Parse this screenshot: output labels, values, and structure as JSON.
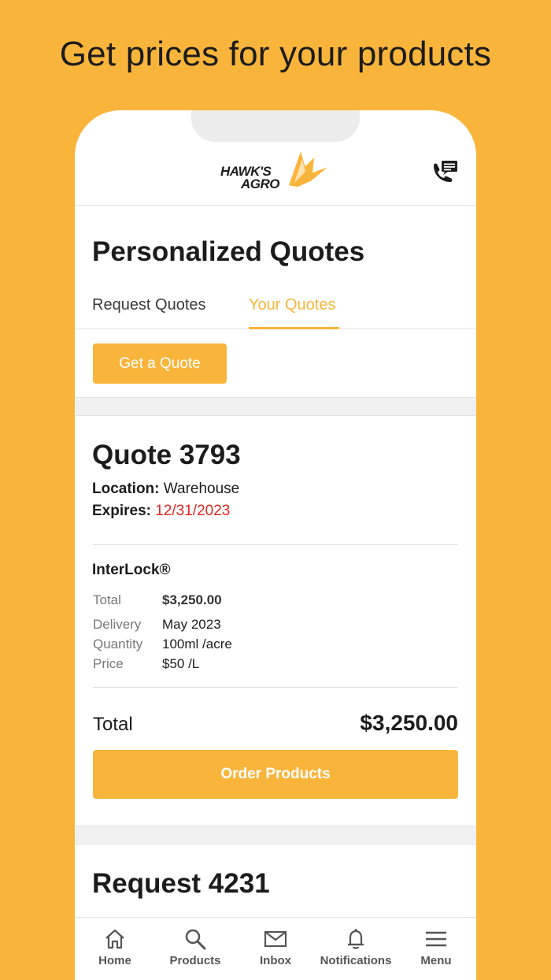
{
  "promo": {
    "headline": "Get prices for your products"
  },
  "header": {
    "logo_line1": "HAWK'S",
    "logo_line2": "AGRO",
    "brand_color": "#F9B53B",
    "contact_icon": "phone-message-icon"
  },
  "page": {
    "title": "Personalized Quotes",
    "tabs": [
      {
        "label": "Request Quotes",
        "active": false
      },
      {
        "label": "Your Quotes",
        "active": true
      }
    ],
    "get_quote_label": "Get a Quote"
  },
  "quote": {
    "title": "Quote 3793",
    "location_label": "Location:",
    "location_value": "Warehouse",
    "expires_label": "Expires:",
    "expires_value": "12/31/2023",
    "expires_color": "#e0271f",
    "product": {
      "name": "InterLock®",
      "rows": [
        {
          "label": "Total",
          "value": "$3,250.00"
        },
        {
          "label": "Delivery",
          "value": "May 2023"
        },
        {
          "label": "Quantity",
          "value": "100ml /acre"
        },
        {
          "label": "Price",
          "value": "$50 /L"
        }
      ]
    },
    "total_label": "Total",
    "total_value": "$3,250.00",
    "order_label": "Order Products"
  },
  "request": {
    "title": "Request 4231"
  },
  "nav": {
    "items": [
      {
        "label": "Home",
        "icon": "home-icon"
      },
      {
        "label": "Products",
        "icon": "search-icon"
      },
      {
        "label": "Inbox",
        "icon": "mail-icon"
      },
      {
        "label": "Notifications",
        "icon": "bell-icon"
      },
      {
        "label": "Menu",
        "icon": "menu-icon"
      }
    ]
  }
}
